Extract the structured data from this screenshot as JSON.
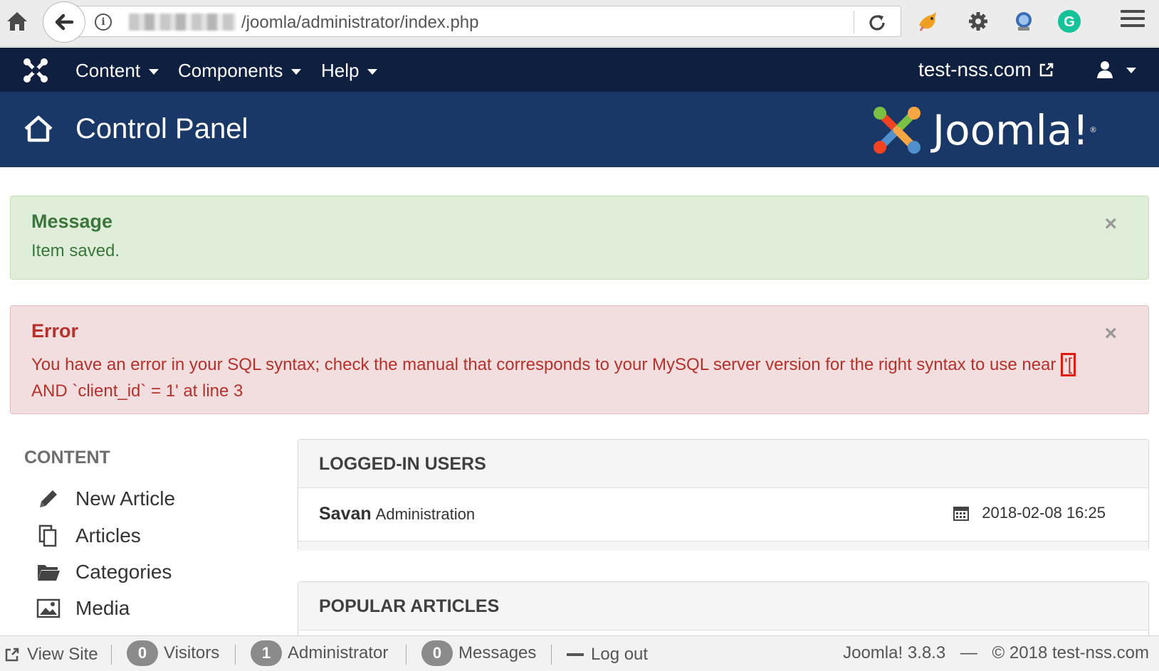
{
  "browser": {
    "url": "/joomla/administrator/index.php"
  },
  "nav": {
    "items": [
      {
        "label": "Content"
      },
      {
        "label": "Components"
      },
      {
        "label": "Help"
      }
    ],
    "site_link": "test-nss.com"
  },
  "header": {
    "title": "Control Panel",
    "brand": "Joomla!",
    "brand_mark": "®"
  },
  "messages": {
    "success": {
      "heading": "Message",
      "text": "Item saved.",
      "close": "×"
    },
    "error": {
      "heading": "Error",
      "text_before": "You have an error in your SQL syntax; check the manual that corresponds to your MySQL server version for the right syntax to use near ",
      "text_highlight": "'[",
      "text_after": " AND `client_id` = 1' at line 3",
      "close": "×"
    }
  },
  "sidebar": {
    "heading": "CONTENT",
    "items": [
      {
        "label": "New Article",
        "icon": "pencil-icon"
      },
      {
        "label": "Articles",
        "icon": "copy-icon"
      },
      {
        "label": "Categories",
        "icon": "folder-icon"
      },
      {
        "label": "Media",
        "icon": "image-icon"
      }
    ]
  },
  "panels": {
    "logged_in": {
      "title": "LOGGED-IN USERS",
      "user": "Savan",
      "role": "Administration",
      "date": "2018-02-08 16:25"
    },
    "popular": {
      "title": "POPULAR ARTICLES"
    }
  },
  "status_bar": {
    "view_site": "View Site",
    "visitors_count": "0",
    "visitors_label": "Visitors",
    "admin_count": "1",
    "admin_label": "Administrator",
    "messages_count": "0",
    "messages_label": "Messages",
    "logout": "Log out",
    "version": "Joomla! 3.8.3",
    "dash": "—",
    "copyright": "© 2018 test-nss.com"
  }
}
